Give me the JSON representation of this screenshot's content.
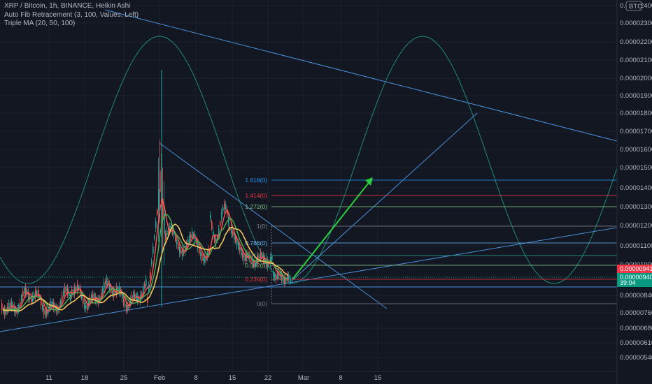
{
  "legend": {
    "title": "XRP / Bitcoin, 1h, BINANCE, Heikin Ashi",
    "fib": "Auto Fib Retracement (3, 100, Values, Left)",
    "ma": "Triple MA (20, 50, 100)"
  },
  "currency_badge": "BTC",
  "colors": {
    "background": "#131722",
    "grid": "#1e2230",
    "up": "#26a69a",
    "down": "#ef5350",
    "ma20": "#ff5252",
    "ma50": "#4caf50",
    "ma100": "#f0c45a",
    "trendline": "#4a8fd6",
    "wave": "#1f8a78",
    "arrow": "#2ecc40",
    "price_red": "#f23645",
    "price_green": "#089981"
  },
  "chart_data": {
    "type": "candlestick",
    "symbol": "XRP / Bitcoin",
    "timeframe": "1h",
    "exchange": "BINANCE",
    "y_ticks": [
      "0.00002400",
      "0.00002300",
      "0.00002200",
      "0.00002100",
      "0.00002000",
      "0.00001900",
      "0.00001800",
      "0.00001700",
      "0.00001600",
      "0.00001500",
      "0.00001400",
      "0.00001300",
      "0.00001200",
      "0.00001100",
      "0.00001000",
      "0.00000920",
      "0.00000840",
      "0.00000760",
      "0.00000680",
      "0.00000610",
      "0.00000540"
    ],
    "x_ticks": [
      "11",
      "18",
      "25",
      "Feb",
      "8",
      "15",
      "22",
      "Mar",
      "8",
      "15"
    ],
    "fib_levels": [
      {
        "label": "1.618(0)",
        "color": "#2196f3"
      },
      {
        "label": "1.414(0)",
        "color": "#f23645"
      },
      {
        "label": "1.272(0)",
        "color": "#81c784"
      },
      {
        "label": "1(0)",
        "color": "#787b86"
      },
      {
        "label": "0.786(0)",
        "color": "#64b5f6"
      },
      {
        "label": "0.618(0)",
        "color": "#26a69a"
      },
      {
        "label": "0.382(0)",
        "color": "#81c784"
      },
      {
        "label": "0.236(0)",
        "color": "#f23645"
      },
      {
        "label": "0(0)",
        "color": "#787b86"
      }
    ],
    "price_labels": [
      {
        "value": "0.00000941",
        "color": "#f23645"
      },
      {
        "value": "0.00000940",
        "color": "#089981"
      },
      {
        "value": "39:04",
        "color": "#089981"
      }
    ],
    "indicators": [
      "Auto Fib Retracement (3, 100, Values, Left)",
      "Triple MA (20, 50, 100)"
    ]
  }
}
